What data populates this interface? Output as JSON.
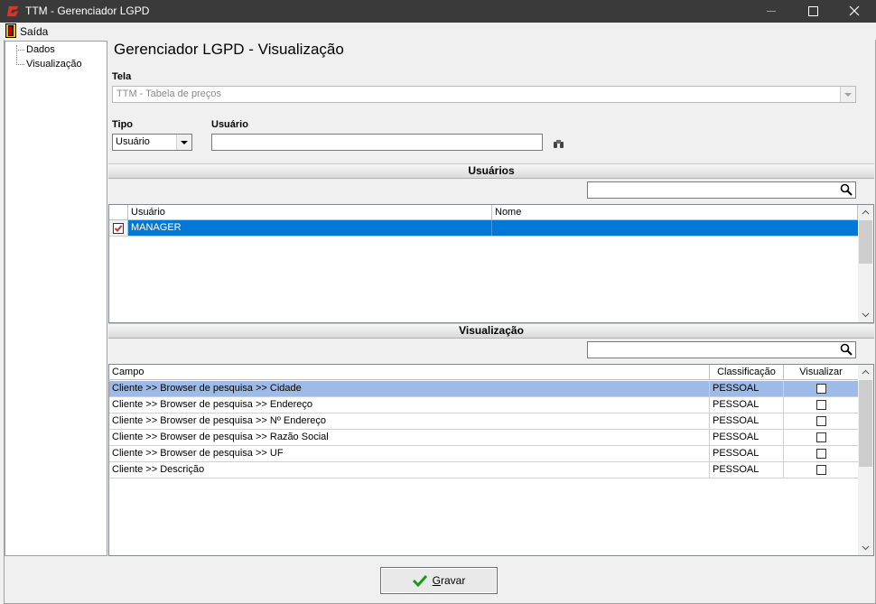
{
  "window": {
    "title": "TTM - Gerenciador LGPD"
  },
  "menu": {
    "items": [
      {
        "label": "Saída",
        "icon": "exit-door-icon"
      }
    ]
  },
  "tree": {
    "items": [
      {
        "label": "Dados"
      },
      {
        "label": "Visualização"
      }
    ]
  },
  "page": {
    "title": "Gerenciador LGPD - Visualização"
  },
  "form": {
    "tela_label": "Tela",
    "tela_value": "TTM - Tabela de preços",
    "tipo_label": "Tipo",
    "tipo_value": "Usuário",
    "usuario_label": "Usuário",
    "usuario_value": ""
  },
  "usuarios": {
    "section_title": "Usuários",
    "search_value": "",
    "columns": [
      "Usuário",
      "Nome"
    ],
    "rows": [
      {
        "checked": true,
        "usuario": "MANAGER",
        "nome": ""
      }
    ]
  },
  "visualizacao": {
    "section_title": "Visualização",
    "search_value": "",
    "columns": [
      "Campo",
      "Classificação",
      "Visualizar"
    ],
    "rows": [
      {
        "campo": "Cliente >> Browser de pesquisa >> Cidade",
        "classificacao": "PESSOAL",
        "visualizar": false
      },
      {
        "campo": "Cliente >> Browser de pesquisa >> Endereço",
        "classificacao": "PESSOAL",
        "visualizar": false
      },
      {
        "campo": "Cliente >> Browser de pesquisa >> Nº Endereço",
        "classificacao": "PESSOAL",
        "visualizar": false
      },
      {
        "campo": "Cliente >> Browser de pesquisa >> Razão Social",
        "classificacao": "PESSOAL",
        "visualizar": false
      },
      {
        "campo": "Cliente >> Browser de pesquisa >> UF",
        "classificacao": "PESSOAL",
        "visualizar": false
      },
      {
        "campo": "Cliente >> Descrição",
        "classificacao": "PESSOAL",
        "visualizar": false
      }
    ]
  },
  "footer": {
    "save_label": "Gravar",
    "save_accel": "G",
    "save_rest": "ravar"
  },
  "colors": {
    "titlebar": "#3a3a3a",
    "selection": "#0078d7",
    "selection_light": "#9ebbe8",
    "accent": "#d32f2f",
    "ok_green": "#1a9a1a"
  }
}
